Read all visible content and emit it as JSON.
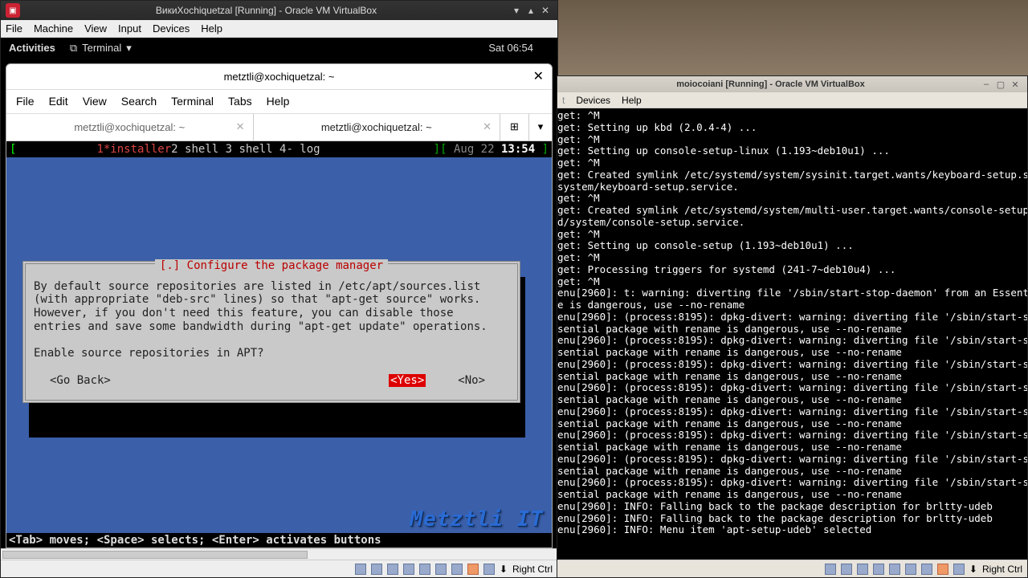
{
  "vm1": {
    "title": "ВикиXochiquetzal [Running] - Oracle VM VirtualBox",
    "menubar": [
      "File",
      "Machine",
      "View",
      "Input",
      "Devices",
      "Help"
    ],
    "gnome": {
      "activities": "Activities",
      "app": "Terminal",
      "clock": "Sat 06:54"
    },
    "term": {
      "title": "metztli@xochiquetzal: ~",
      "menu": [
        "File",
        "Edit",
        "View",
        "Search",
        "Terminal",
        "Tabs",
        "Help"
      ],
      "tabs": [
        {
          "label": "metztli@xochiquetzal: ~",
          "active": false
        },
        {
          "label": "metztli@xochiquetzal: ~",
          "active": true
        }
      ],
      "tmux": {
        "left_bracket": "[",
        "tab1": "1*installer",
        "rest": "  2 shell  3 shell  4- log",
        "right_bracket": "][",
        "date": "Aug 22 ",
        "time": "13:54",
        "end_bracket": " ]"
      },
      "installer": {
        "title": "[.] Configure the package manager",
        "body": "By default source repositories are listed in /etc/apt/sources.list\n(with appropriate \"deb-src\" lines) so that \"apt-get source\" works.\nHowever, if you don't need this feature, you can disable those\nentries and save some bandwidth during \"apt-get update\" operations.\n\nEnable source repositories in APT?",
        "go_back": "<Go Back>",
        "yes": "<Yes>",
        "no": "<No>"
      },
      "footer": "<Tab> moves; <Space> selects; <Enter> activates buttons",
      "watermark": "Metztli IT"
    },
    "statusbar": {
      "hostkey": "Right Ctrl"
    }
  },
  "vm2": {
    "title": "moiocoiani [Running] - Oracle VM VirtualBox",
    "menubar_visible": [
      "Devices",
      "Help"
    ],
    "console_lines": [
      "get: ^M",
      "get: Setting up kbd (2.0.4-4) ...",
      "get: ^M",
      "get: Setting up console-setup-linux (1.193~deb10u1) ...",
      "get: ^M",
      "get: Created symlink /etc/systemd/system/sysinit.target.wants/keyboard-setup.s",
      "system/keyboard-setup.service.",
      "get: ^M",
      "get: Created symlink /etc/systemd/system/multi-user.target.wants/console-setup",
      "d/system/console-setup.service.",
      "get: ^M",
      "get: Setting up console-setup (1.193~deb10u1) ...",
      "get: ^M",
      "get: Processing triggers for systemd (241-7~deb10u4) ...",
      "get: ^M",
      "enu[2960]: t: warning: diverting file '/sbin/start-stop-daemon' from an Essent",
      "e is dangerous, use --no-rename",
      "enu[2960]: (process:8195): dpkg-divert: warning: diverting file '/sbin/start-s",
      "sential package with rename is dangerous, use --no-rename",
      "enu[2960]: (process:8195): dpkg-divert: warning: diverting file '/sbin/start-s",
      "sential package with rename is dangerous, use --no-rename",
      "enu[2960]: (process:8195): dpkg-divert: warning: diverting file '/sbin/start-s",
      "sential package with rename is dangerous, use --no-rename",
      "enu[2960]: (process:8195): dpkg-divert: warning: diverting file '/sbin/start-s",
      "sential package with rename is dangerous, use --no-rename",
      "enu[2960]: (process:8195): dpkg-divert: warning: diverting file '/sbin/start-s",
      "sential package with rename is dangerous, use --no-rename",
      "enu[2960]: (process:8195): dpkg-divert: warning: diverting file '/sbin/start-s",
      "sential package with rename is dangerous, use --no-rename",
      "enu[2960]: (process:8195): dpkg-divert: warning: diverting file '/sbin/start-s",
      "sential package with rename is dangerous, use --no-rename",
      "enu[2960]: (process:8195): dpkg-divert: warning: diverting file '/sbin/start-s",
      "sential package with rename is dangerous, use --no-rename",
      "enu[2960]: INFO: Falling back to the package description for brltty-udeb",
      "enu[2960]: INFO: Falling back to the package description for brltty-udeb",
      "enu[2960]: INFO: Menu item 'apt-setup-udeb' selected"
    ],
    "statusbar": {
      "hostkey": "Right Ctrl"
    }
  }
}
